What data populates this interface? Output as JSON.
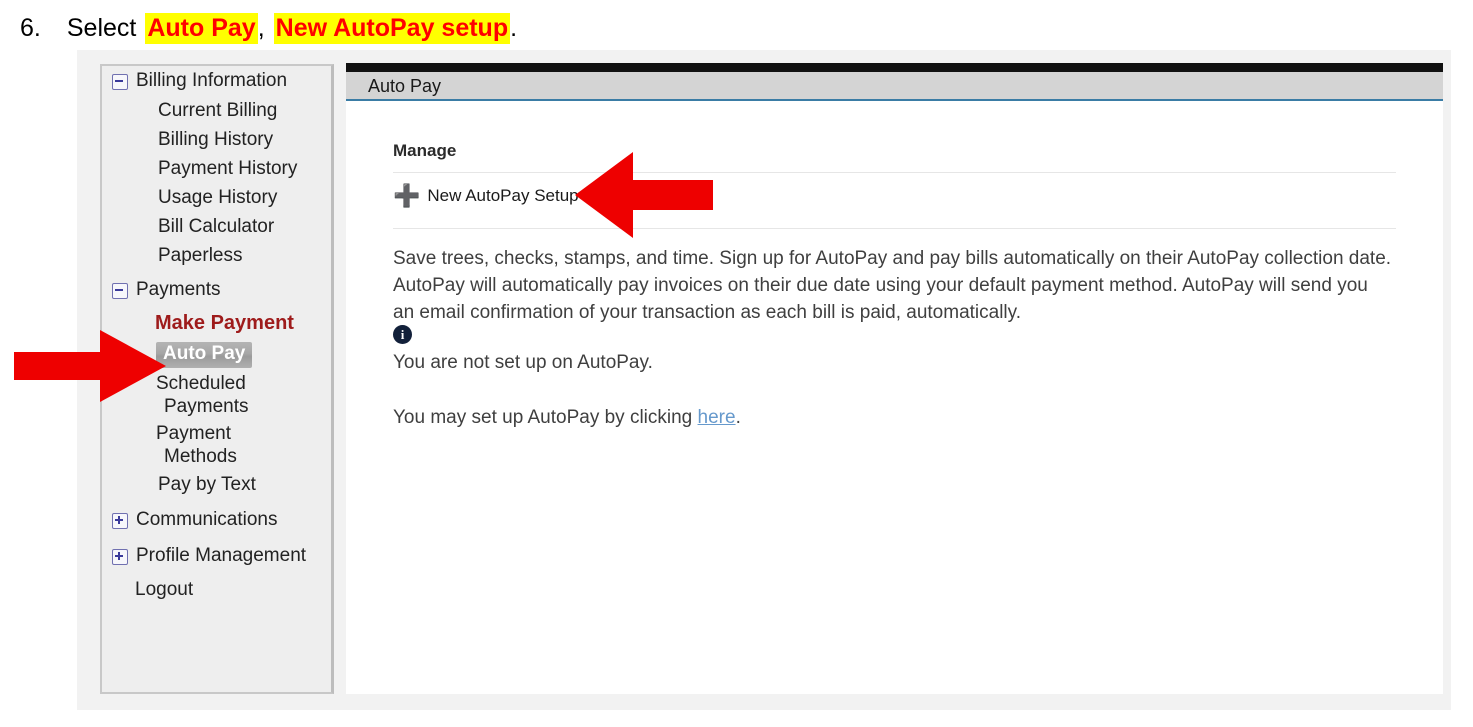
{
  "instruction": {
    "number": "6.",
    "lead": "Select",
    "highlight_1": "Auto Pay",
    "separator": ",",
    "highlight_2": "New AutoPay setup",
    "trailing": "."
  },
  "sidebar": {
    "groups": [
      {
        "label": "Billing Information",
        "icon": "minus-box-icon",
        "expanded": true,
        "children": [
          {
            "label": "Current Billing"
          },
          {
            "label": "Billing History"
          },
          {
            "label": "Payment History"
          },
          {
            "label": "Usage History"
          },
          {
            "label": "Bill Calculator"
          },
          {
            "label": "Paperless"
          }
        ]
      },
      {
        "label": "Payments",
        "icon": "minus-box-icon",
        "expanded": true,
        "children": [
          {
            "label": "Make Payment",
            "style": "emphasis"
          },
          {
            "label": "Auto Pay",
            "style": "selected"
          },
          {
            "label_line1": "Scheduled",
            "label_line2": "Payments"
          },
          {
            "label_line1": "Payment",
            "label_line2": "Methods"
          },
          {
            "label": "Pay by Text"
          }
        ]
      },
      {
        "label": "Communications",
        "icon": "plus-box-icon",
        "expanded": false,
        "children": []
      },
      {
        "label": "Profile Management",
        "icon": "plus-box-icon",
        "expanded": false,
        "children": []
      }
    ],
    "logout_label": "Logout"
  },
  "content": {
    "tab_label": "Auto Pay",
    "manage_heading": "Manage",
    "new_setup_label": "New AutoPay Setup",
    "new_setup_icon": "plus-icon",
    "body_paragraph": "Save trees, checks, stamps, and time. Sign up for AutoPay and pay bills automatically on their AutoPay collection date. AutoPay will automatically pay invoices on their due date using your default payment method. AutoPay will send you an email confirmation of your transaction as each bill is paid, automatically.",
    "info_icon": "info-icon",
    "info_icon_glyph": "i",
    "status_text": "You are not set up on AutoPay.",
    "setup_hint_prefix": "You may set up AutoPay by clicking ",
    "setup_hint_link": "here",
    "setup_hint_suffix": "."
  },
  "annotations": {
    "arrow_sidebar": "red-arrow-right-icon",
    "arrow_content": "red-arrow-left-icon",
    "arrow_color": "#ee0000"
  },
  "colors": {
    "highlight_background": "#ffff00",
    "highlight_text": "#ff0000",
    "emphasis_nav": "#9e1b1b",
    "selected_nav_text": "#ffffff",
    "tab_underline": "#3a7ca5",
    "link": "#6699cc",
    "info_icon": "#12203a"
  }
}
